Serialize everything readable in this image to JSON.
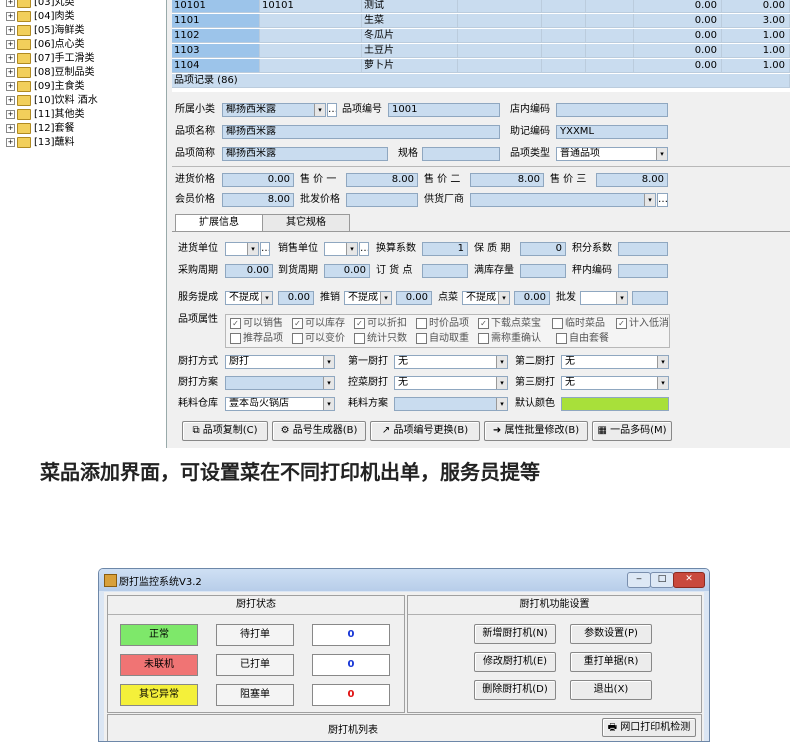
{
  "tree": [
    {
      "label": "[03]丸类"
    },
    {
      "label": "[04]肉类"
    },
    {
      "label": "[05]海鲜类"
    },
    {
      "label": "[06]点心类"
    },
    {
      "label": "[07]手工滑类"
    },
    {
      "label": "[08]豆制品类"
    },
    {
      "label": "[09]主食类"
    },
    {
      "label": "[10]饮料 酒水"
    },
    {
      "label": "[11]其他类"
    },
    {
      "label": "[12]套餐"
    },
    {
      "label": "[13]蘸料"
    }
  ],
  "grid": {
    "rows": [
      {
        "code": "10101",
        "code2": "10101",
        "name": "测试",
        "v1": "0.00",
        "v2": "0.00"
      },
      {
        "code": "1101",
        "code2": "",
        "name": "生菜",
        "v1": "0.00",
        "v2": "3.00"
      },
      {
        "code": "1102",
        "code2": "",
        "name": "冬瓜片",
        "v1": "0.00",
        "v2": "1.00"
      },
      {
        "code": "1103",
        "code2": "",
        "name": "土豆片",
        "v1": "0.00",
        "v2": "1.00"
      },
      {
        "code": "1104",
        "code2": "",
        "name": "萝卜片",
        "v1": "0.00",
        "v2": "1.00"
      }
    ],
    "footer": "品项记录 (86)"
  },
  "form": {
    "category_label": "所属小类",
    "category_value": "椰扬西米露",
    "item_no_label": "品项编号",
    "item_no_value": "1001",
    "store_code_label": "店内编码",
    "store_code_value": "",
    "item_name_label": "品项名称",
    "item_name_value": "椰扬西米露",
    "mnemonic_label": "助记编码",
    "mnemonic_value": "YXXML",
    "short_name_label": "品项简称",
    "short_name_value": "椰扬西米露",
    "spec_label": "规格",
    "spec_value": "",
    "item_type_label": "品项类型",
    "item_type_value": "普通品项",
    "purchase_price_label": "进货价格",
    "purchase_price_value": "0.00",
    "price1_label": "售 价 一",
    "price1_value": "8.00",
    "price2_label": "售 价 二",
    "price2_value": "8.00",
    "price3_label": "售 价 三",
    "price3_value": "8.00",
    "member_price_label": "会员价格",
    "member_price_value": "8.00",
    "wholesale_label": "批发价格",
    "wholesale_value": "",
    "supplier_label": "供货厂商",
    "supplier_value": ""
  },
  "tabs": [
    {
      "label": "扩展信息"
    },
    {
      "label": "其它规格"
    }
  ],
  "ext": {
    "in_unit_label": "进货单位",
    "sale_unit_label": "销售单位",
    "conv_label": "换算系数",
    "conv_value": "1",
    "shelf_label": "保 质 期",
    "shelf_value": "0",
    "points_label": "积分系数",
    "points_value": "",
    "cycle_label": "采购周期",
    "cycle_value": "0.00",
    "arrival_label": "到货周期",
    "arrival_value": "0.00",
    "reorder_label": "订 货 点",
    "reorder_value": "",
    "full_label": "满库存量",
    "full_value": "",
    "inner_label": "秤内编码",
    "inner_value": "",
    "svc_label": "服务提成",
    "svc_value": "不提成",
    "svc_amt": "0.00",
    "promo_label": "推销",
    "promo_value": "不提成",
    "promo_amt": "0.00",
    "order_label": "点菜",
    "order_value": "不提成",
    "order_amt": "0.00",
    "batch_label": "批发",
    "attr_label": "品项属性",
    "attrs_row1": [
      {
        "label": "可以销售",
        "checked": "✓"
      },
      {
        "label": "可以库存",
        "checked": "✓"
      },
      {
        "label": "可以折扣",
        "checked": "✓"
      },
      {
        "label": "时价品项",
        "checked": ""
      },
      {
        "label": "下载点菜宝",
        "checked": "✓"
      },
      {
        "label": "临时菜品",
        "checked": ""
      },
      {
        "label": "计入低消",
        "checked": "✓"
      }
    ],
    "attrs_row2": [
      {
        "label": "推荐品项",
        "checked": ""
      },
      {
        "label": "可以变价",
        "checked": ""
      },
      {
        "label": "统计只数",
        "checked": ""
      },
      {
        "label": "自动取重",
        "checked": ""
      },
      {
        "label": "需称重确认",
        "checked": ""
      },
      {
        "label": "自由套餐",
        "checked": ""
      }
    ],
    "kitchen_mode_label": "厨打方式",
    "kitchen_mode_value": "厨打",
    "printer1_label": "第一厨打",
    "printer1_value": "无",
    "printer2_label": "第二厨打",
    "printer2_value": "无",
    "kitchen_plan_label": "厨打方案",
    "kitchen_plan_value": "",
    "ctrl_label": "控菜厨打",
    "ctrl_value": "无",
    "printer3_label": "第三厨打",
    "printer3_value": "无",
    "store_label": "耗料仓库",
    "store_value": "壹本岛火锅店",
    "plan_label": "耗料方案",
    "plan_value": "",
    "color_label": "默认颜色",
    "color_value": "#a8e03a"
  },
  "buttons": [
    {
      "label": "品项复制(C)"
    },
    {
      "label": "品号生成器(B)"
    },
    {
      "label": "品项编号更换(B)"
    },
    {
      "label": "属性批量修改(B)"
    },
    {
      "label": "一品多码(M)"
    }
  ],
  "caption": "菜品添加界面，可设置菜在不同打印机出单，服务员提等",
  "monitor": {
    "title": "厨打监控系统V3.2",
    "status_header": "厨打状态",
    "func_header": "厨打机功能设置",
    "status": [
      {
        "label": "正常",
        "color": "#7ee86a",
        "type": "待打单",
        "count": "0",
        "count_color": "#1535d6"
      },
      {
        "label": "未联机",
        "color": "#f07474",
        "type": "已打单",
        "count": "0",
        "count_color": "#1535d6"
      },
      {
        "label": "其它异常",
        "color": "#f4f03a",
        "type": "阻塞单",
        "count": "0",
        "count_color": "#e01010"
      }
    ],
    "func_buttons": [
      {
        "label": "新增厨打机(N)"
      },
      {
        "label": "参数设置(P)"
      },
      {
        "label": "修改厨打机(E)"
      },
      {
        "label": "重打单据(R)"
      },
      {
        "label": "删除厨打机(D)"
      },
      {
        "label": "退出(X)"
      }
    ],
    "list_header": "厨打机列表",
    "detect_button": "网口打印机检测"
  }
}
